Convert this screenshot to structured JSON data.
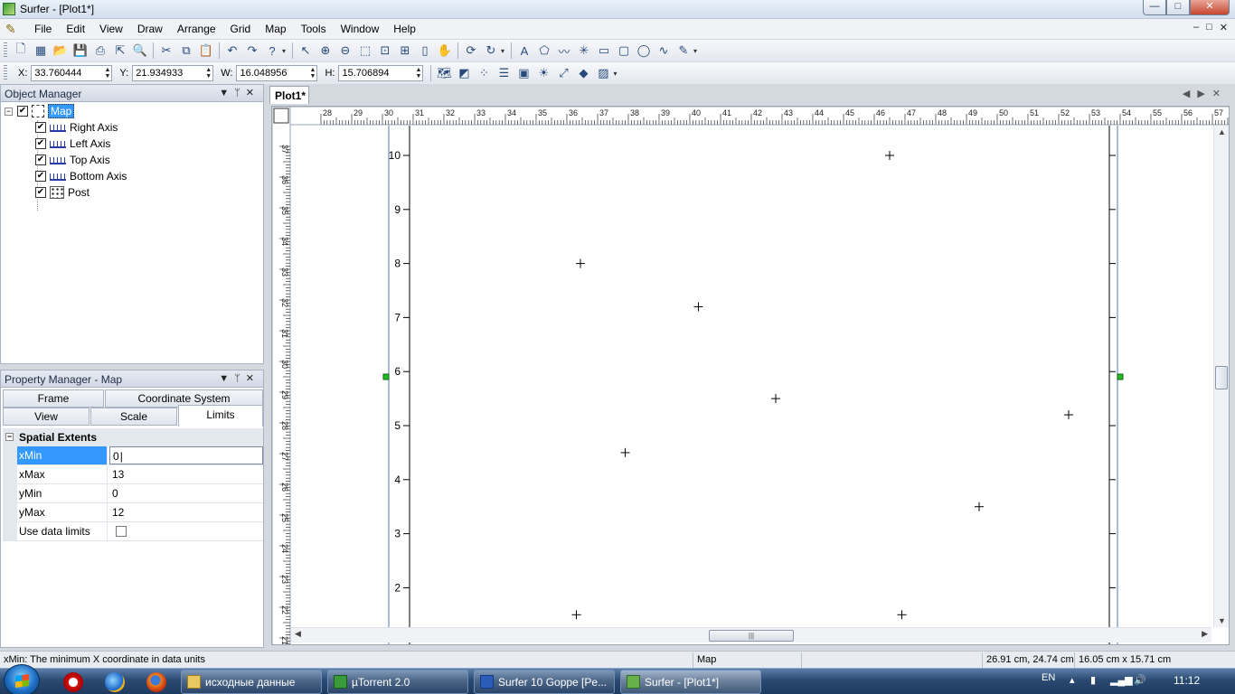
{
  "window": {
    "title": "Surfer - [Plot1*]",
    "buttons": {
      "minimize": "—",
      "maximize": "□",
      "close": "✕"
    }
  },
  "menubar": {
    "items": [
      "File",
      "Edit",
      "View",
      "Draw",
      "Arrange",
      "Grid",
      "Map",
      "Tools",
      "Window",
      "Help"
    ],
    "mdi_buttons": [
      "–",
      "□",
      "✕"
    ]
  },
  "coords": {
    "x_label": "X:",
    "x_value": "33.760444",
    "y_label": "Y:",
    "y_value": "21.934933",
    "w_label": "W:",
    "w_value": "16.048956",
    "h_label": "H:",
    "h_value": "15.706894"
  },
  "object_manager": {
    "title": "Object Manager",
    "tree": {
      "root": "Map",
      "children": [
        "Right Axis",
        "Left Axis",
        "Top Axis",
        "Bottom Axis",
        "Post"
      ]
    }
  },
  "property_manager": {
    "title": "Property Manager - Map",
    "tabs_row1": [
      "Frame",
      "Coordinate System"
    ],
    "tabs_row2": [
      "View",
      "Scale",
      "Limits"
    ],
    "active_tab": "Limits",
    "section": "Spatial Extents",
    "rows": [
      {
        "name": "xMin",
        "value": "0"
      },
      {
        "name": "xMax",
        "value": "13"
      },
      {
        "name": "yMin",
        "value": "0"
      },
      {
        "name": "yMax",
        "value": "12"
      },
      {
        "name": "Use data limits",
        "value": ""
      }
    ],
    "use_data_limits_checked": false
  },
  "plot": {
    "tab": "Plot1*",
    "nav": [
      "◀",
      "▶",
      "✕"
    ],
    "top_ruler_labels": [
      "28",
      "29",
      "30",
      "31",
      "32",
      "33",
      "34",
      "35",
      "36",
      "37",
      "38",
      "39",
      "40",
      "41",
      "42",
      "43",
      "44",
      "45",
      "46",
      "47",
      "48",
      "49",
      "50",
      "51",
      "52",
      "53",
      "54",
      "55",
      "56",
      "57"
    ],
    "left_ruler_labels": [
      "37",
      "36",
      "35",
      "34",
      "33",
      "32",
      "31",
      "30",
      "29",
      "28",
      "27",
      "26",
      "25",
      "24",
      "23",
      "22",
      "21"
    ]
  },
  "chart_data": {
    "type": "scatter",
    "title": "",
    "xlabel": "",
    "ylabel": "",
    "ylim": [
      1.5,
      10.5
    ],
    "y_ticks": [
      "2",
      "3",
      "4",
      "5",
      "6",
      "7",
      "8",
      "9",
      "10"
    ],
    "marker": "+",
    "series": [
      {
        "points": [
          [
            2.0,
            8.0
          ],
          [
            4.9,
            7.2
          ],
          [
            6.8,
            5.5
          ],
          [
            9.6,
            10.0
          ],
          [
            11.8,
            3.5
          ],
          [
            14.0,
            5.2
          ],
          [
            3.1,
            4.5
          ],
          [
            1.9,
            1.5
          ],
          [
            9.9,
            1.5
          ]
        ]
      }
    ],
    "xlim": [
      -2.2,
      15.0
    ]
  },
  "statusbar": {
    "hint": "xMin: The minimum X coordinate in data units",
    "object": "Map",
    "position": "26.91 cm, 24.74 cm",
    "size": "16.05 cm x 15.71 cm"
  },
  "taskbar": {
    "items": [
      {
        "label": "исходные данные",
        "color": "#e8c860"
      },
      {
        "label": "µTorrent 2.0",
        "color": "#3a9a3a"
      },
      {
        "label": "Surfer 10 Goppe [Pe...",
        "color": "#2a5cb8"
      },
      {
        "label": "Surfer - [Plot1*]",
        "color": "#6ab04a"
      }
    ],
    "lang": "EN",
    "time": "11:12"
  }
}
